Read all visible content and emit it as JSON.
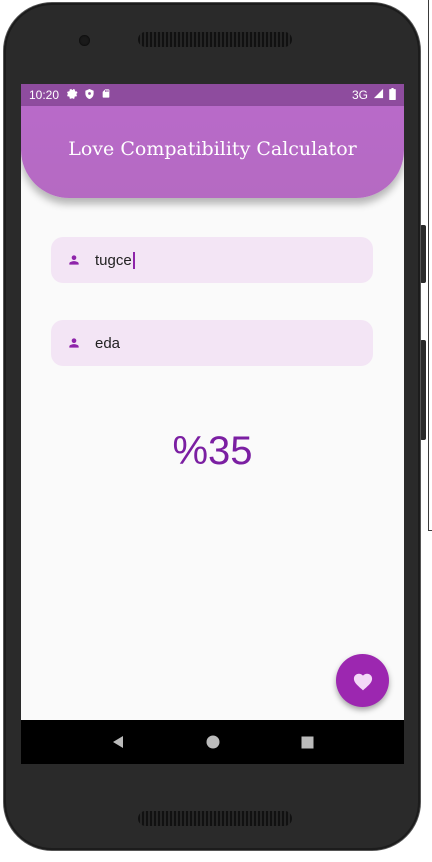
{
  "status_bar": {
    "time": "10:20",
    "network": "3G",
    "icons": [
      "settings-icon",
      "shield-icon",
      "sd-card-icon",
      "signal-icon",
      "battery-icon"
    ]
  },
  "app_bar": {
    "title": "Love Compatibility Calculator"
  },
  "inputs": [
    {
      "value": "tugce",
      "icon": "person-icon"
    },
    {
      "value": "eda",
      "icon": "person-icon"
    }
  ],
  "result": {
    "text": "%35"
  },
  "fab": {
    "icon": "heart-icon"
  },
  "nav_bar": {
    "buttons": [
      "back-icon",
      "home-icon",
      "recents-icon"
    ]
  },
  "colors": {
    "app_bar": "#b86ac9",
    "status_bar": "#8e4c9e",
    "field_background": "#f3e5f5",
    "accent": "#9c27b0",
    "result_text": "#7b1fa2"
  }
}
